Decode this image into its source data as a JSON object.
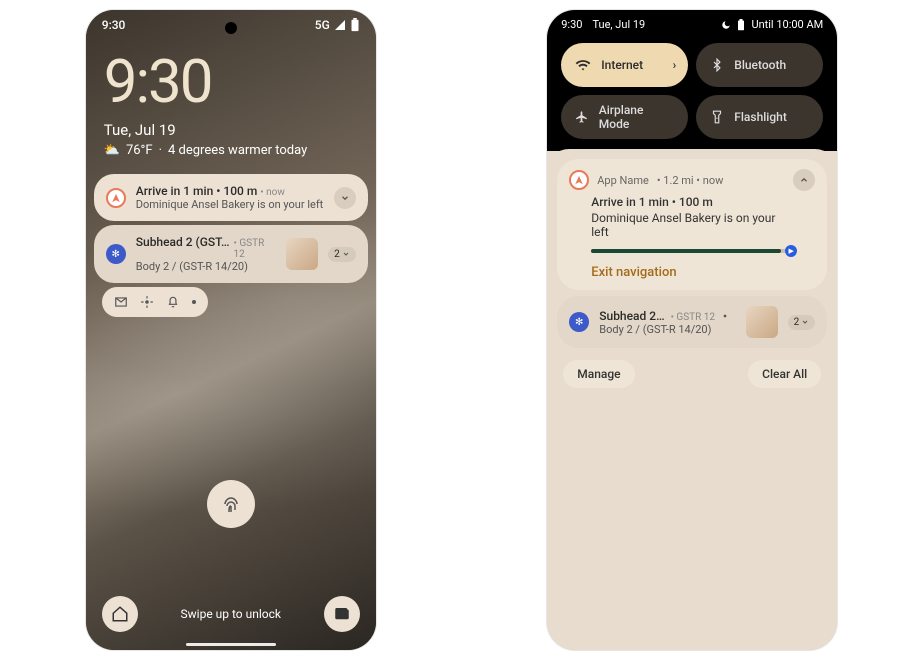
{
  "left": {
    "status": {
      "time": "9:30",
      "network": "5G"
    },
    "clock": "9:30",
    "date": "Tue, Jul 19",
    "weather": {
      "temp": "76°F",
      "delta": "4 degrees warmer today"
    },
    "notifs": [
      {
        "title": "Arrive in 1 min • 100 m",
        "meta": "• now",
        "sub": "Dominique Ansel Bakery is on your left"
      },
      {
        "title": "Subhead 2 (GST-…",
        "meta": "• GSTR 12",
        "sub": "Body 2 / (GST-R 14/20)",
        "count": "2"
      }
    ],
    "unlock_hint": "Swipe up to unlock"
  },
  "right": {
    "status": {
      "time": "9:30",
      "date": "Tue, Jul 19",
      "dnd": "Until 10:00 AM"
    },
    "qs": {
      "internet": "Internet",
      "bluetooth": "Bluetooth",
      "airplane": "Airplane Mode",
      "flashlight": "Flashlight"
    },
    "expanded": {
      "app": "App Name",
      "meta": "• 1.2 mi • now",
      "title": "Arrive in 1 min • 100 m",
      "sub": "Dominique Ansel Bakery is on your left",
      "action": "Exit navigation"
    },
    "collapsed": {
      "title": "Subhead 2…",
      "meta": "• GSTR 12",
      "sub": "Body 2 / (GST-R 14/20)",
      "count": "2"
    },
    "manage": "Manage",
    "clear": "Clear All"
  }
}
